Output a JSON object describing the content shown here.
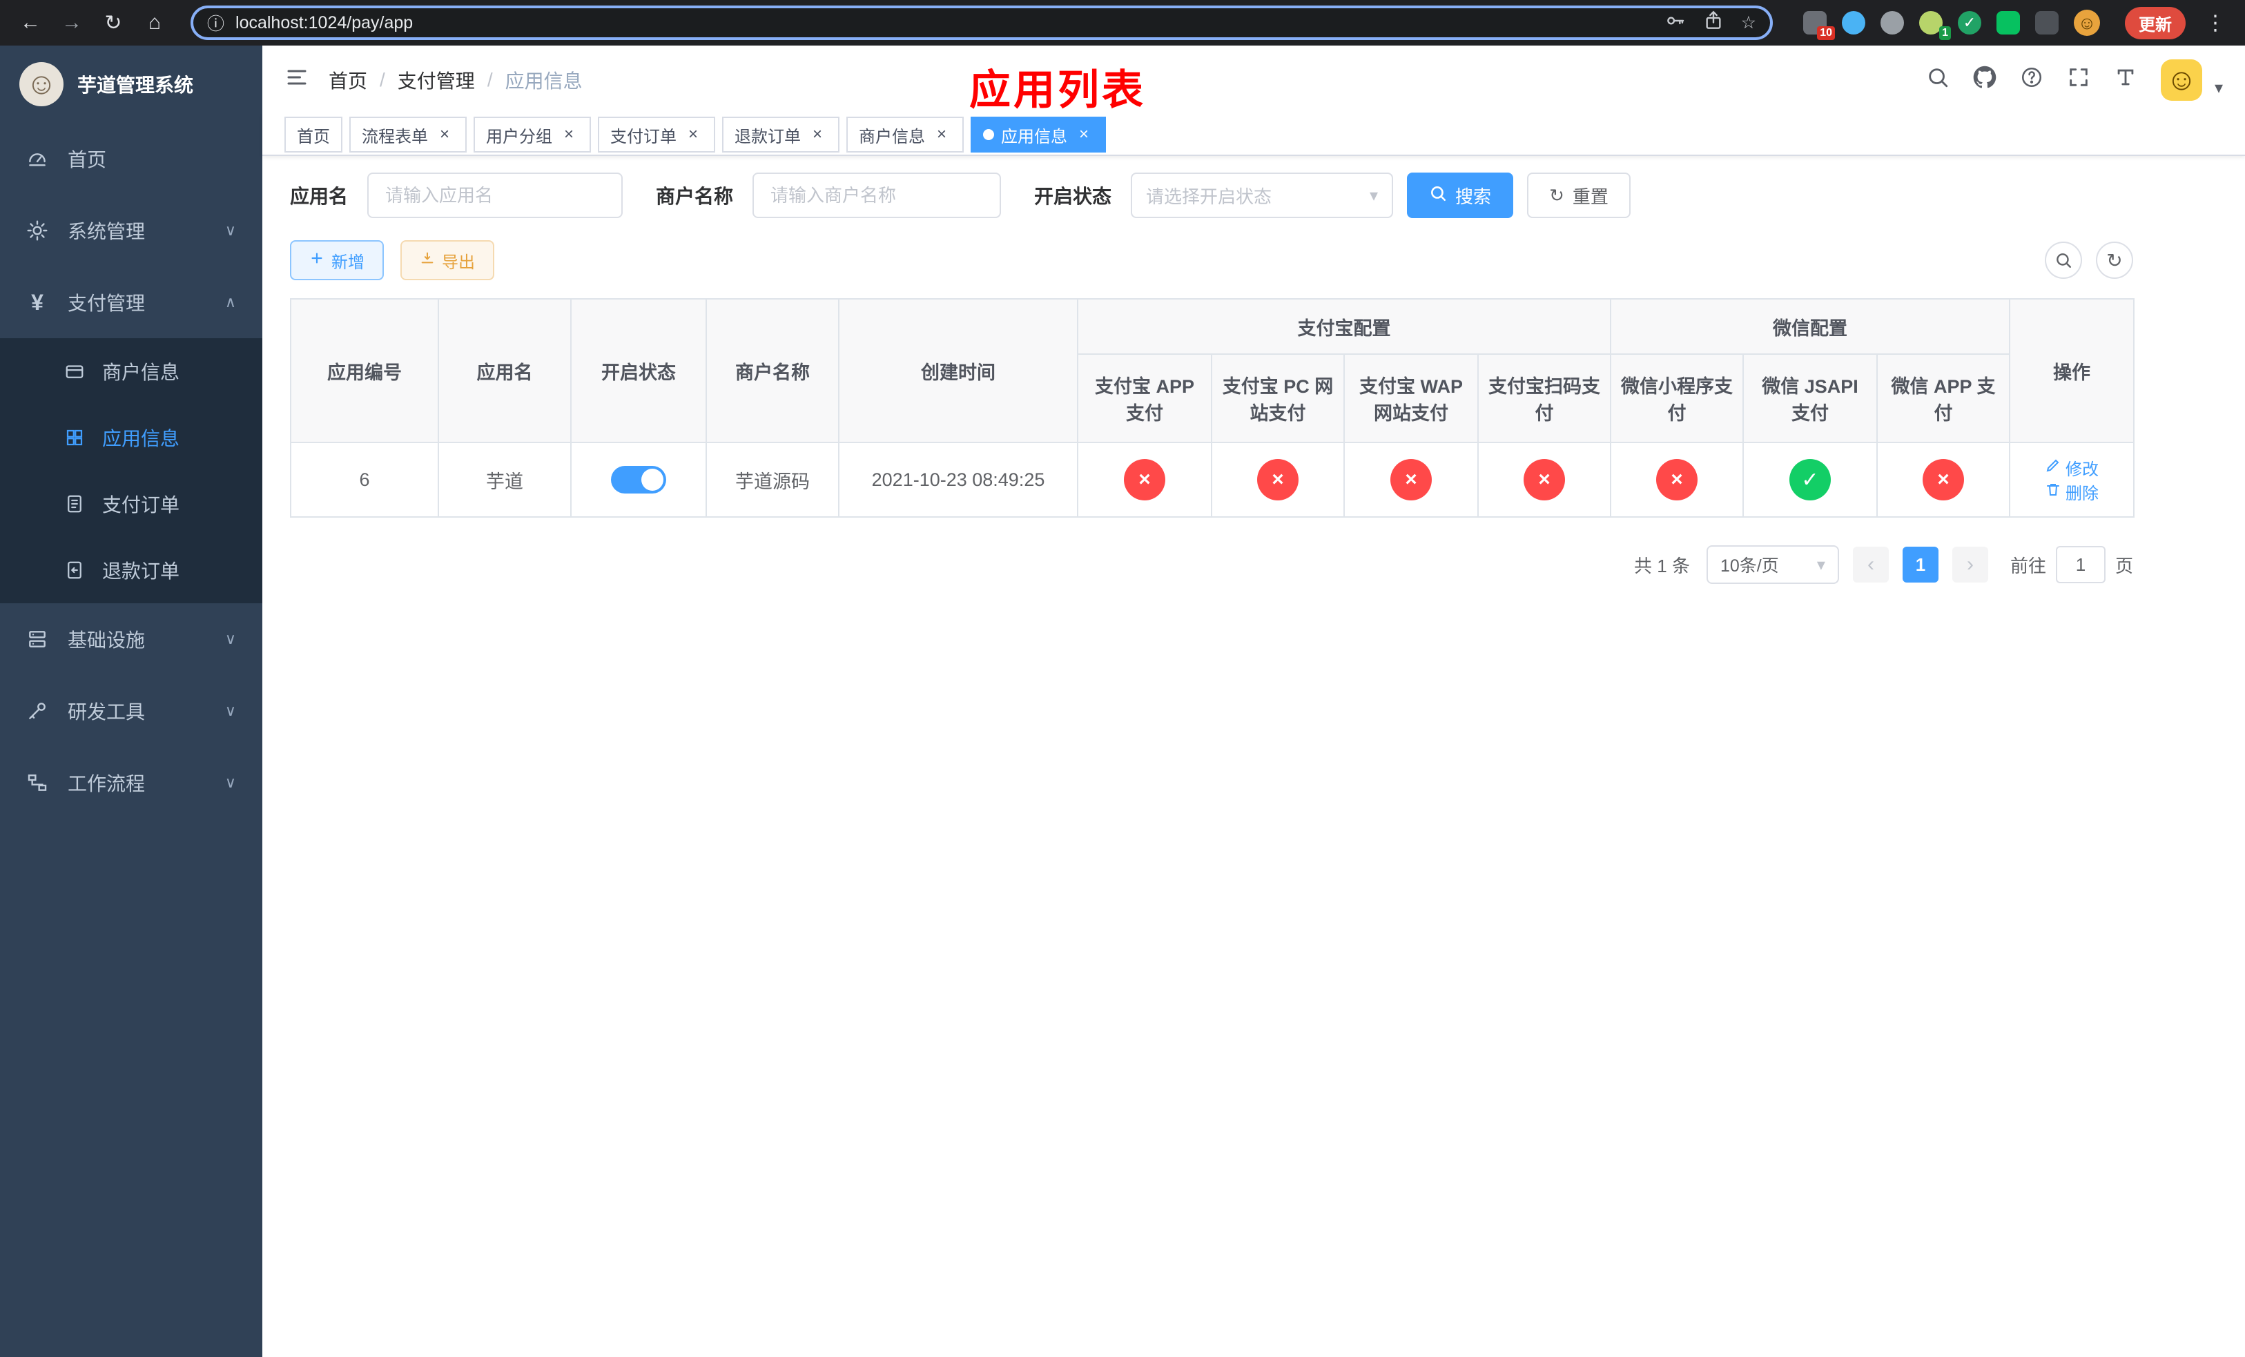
{
  "colors": {
    "accent": "#409eff",
    "success": "#13ce66",
    "danger": "#ff4949",
    "warning": "#e6a23c",
    "page_title": "#ff0000"
  },
  "icons": {
    "back": "←",
    "forward": "→",
    "reload": "↻",
    "home": "⌂",
    "info": "ⓘ",
    "star": "☆",
    "menu_dots": "⋮",
    "close": "×",
    "caret_down": "∨",
    "caret_up": "∧",
    "dropdown": "▾",
    "prev": "‹",
    "next": "›",
    "refresh": "↻",
    "face": "☺"
  },
  "browser": {
    "url": "localhost:1024/pay/app",
    "update_label": "更新",
    "extension_badge": "10",
    "wechat_badge": "1"
  },
  "sidebar": {
    "app_title": "芋道管理系统",
    "menu": [
      {
        "label": "首页"
      },
      {
        "label": "系统管理"
      },
      {
        "label": "支付管理"
      },
      {
        "label": "基础设施"
      },
      {
        "label": "研发工具"
      },
      {
        "label": "工作流程"
      }
    ],
    "payment_submenu": [
      {
        "label": "商户信息"
      },
      {
        "label": "应用信息",
        "active": true
      },
      {
        "label": "支付订单"
      },
      {
        "label": "退款订单"
      }
    ]
  },
  "header": {
    "breadcrumb": [
      "首页",
      "支付管理",
      "应用信息"
    ],
    "separator": "/",
    "page_title": "应用列表"
  },
  "tabs": [
    {
      "label": "首页",
      "closable": false
    },
    {
      "label": "流程表单",
      "closable": true
    },
    {
      "label": "用户分组",
      "closable": true
    },
    {
      "label": "支付订单",
      "closable": true
    },
    {
      "label": "退款订单",
      "closable": true
    },
    {
      "label": "商户信息",
      "closable": true
    },
    {
      "label": "应用信息",
      "closable": true,
      "active": true
    }
  ],
  "filters": {
    "app_name_label": "应用名",
    "app_name_placeholder": "请输入应用名",
    "merchant_label": "商户名称",
    "merchant_placeholder": "请输入商户名称",
    "status_label": "开启状态",
    "status_placeholder": "请选择开启状态",
    "search_label": "搜索",
    "reset_label": "重置"
  },
  "toolbar": {
    "add_label": "新增",
    "export_label": "导出"
  },
  "table": {
    "headers": {
      "app_id": "应用编号",
      "app_name": "应用名",
      "status": "开启状态",
      "merchant": "商户名称",
      "created_at": "创建时间",
      "alipay_group": "支付宝配置",
      "alipay_app": "支付宝 APP 支付",
      "alipay_pc": "支付宝 PC 网站支付",
      "alipay_wap": "支付宝 WAP 网站支付",
      "alipay_qr": "支付宝扫码支付",
      "wechat_group": "微信配置",
      "wechat_mini": "微信小程序支付",
      "wechat_jsapi": "微信 JSAPI 支付",
      "wechat_app": "微信 APP 支付",
      "actions": "操作"
    },
    "rows": [
      {
        "app_id": "6",
        "app_name": "芋道",
        "status_enabled": true,
        "merchant": "芋道源码",
        "created_at": "2021-10-23 08:49:25",
        "channels": [
          {
            "key": "alipay_app",
            "enabled": false,
            "glyph": "×"
          },
          {
            "key": "alipay_pc",
            "enabled": false,
            "glyph": "×"
          },
          {
            "key": "alipay_wap",
            "enabled": false,
            "glyph": "×"
          },
          {
            "key": "alipay_qr",
            "enabled": false,
            "glyph": "×"
          },
          {
            "key": "wechat_mini",
            "enabled": false,
            "glyph": "×"
          },
          {
            "key": "wechat_jsapi",
            "enabled": true,
            "glyph": "✓"
          },
          {
            "key": "wechat_app",
            "enabled": false,
            "glyph": "×"
          }
        ],
        "edit_label": "修改",
        "delete_label": "删除"
      }
    ]
  },
  "pagination": {
    "total_text": "共 1 条",
    "page_size_label": "10条/页",
    "current_page": "1",
    "goto_label": "前往",
    "goto_value": "1",
    "page_unit": "页"
  }
}
